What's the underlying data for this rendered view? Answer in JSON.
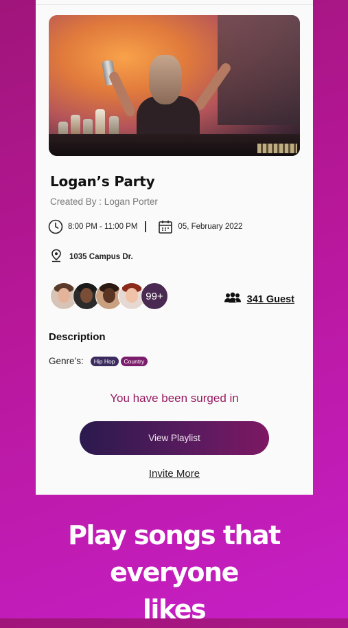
{
  "event": {
    "title": "Logan’s Party",
    "created_by": "Created By : Logan Porter",
    "time": "8:00 PM - 11:00 PM",
    "date": "05, February 2022",
    "address": "1035 Campus Dr.",
    "more_guests_badge": "99+",
    "guest_count_label": "341 Guest"
  },
  "details": {
    "description_heading": "Description",
    "genre_label": "Genre’s:",
    "genres": [
      "Hip Hop",
      "Country"
    ]
  },
  "status": {
    "message": "You have been surged in"
  },
  "actions": {
    "view_playlist": "View Playlist",
    "invite_more": "Invite More"
  },
  "promo": {
    "caption_line1": "Play songs that everyone",
    "caption_line2": "likes"
  },
  "icons": {
    "time": "clock-icon",
    "date": "calendar-icon",
    "location": "map-pin-icon",
    "guests": "group-icon"
  },
  "colors": {
    "accent": "#96195f",
    "button_start": "#2b1a4e",
    "button_end": "#7d1763",
    "background_start": "#a0157a",
    "background_end": "#c61fc6"
  }
}
